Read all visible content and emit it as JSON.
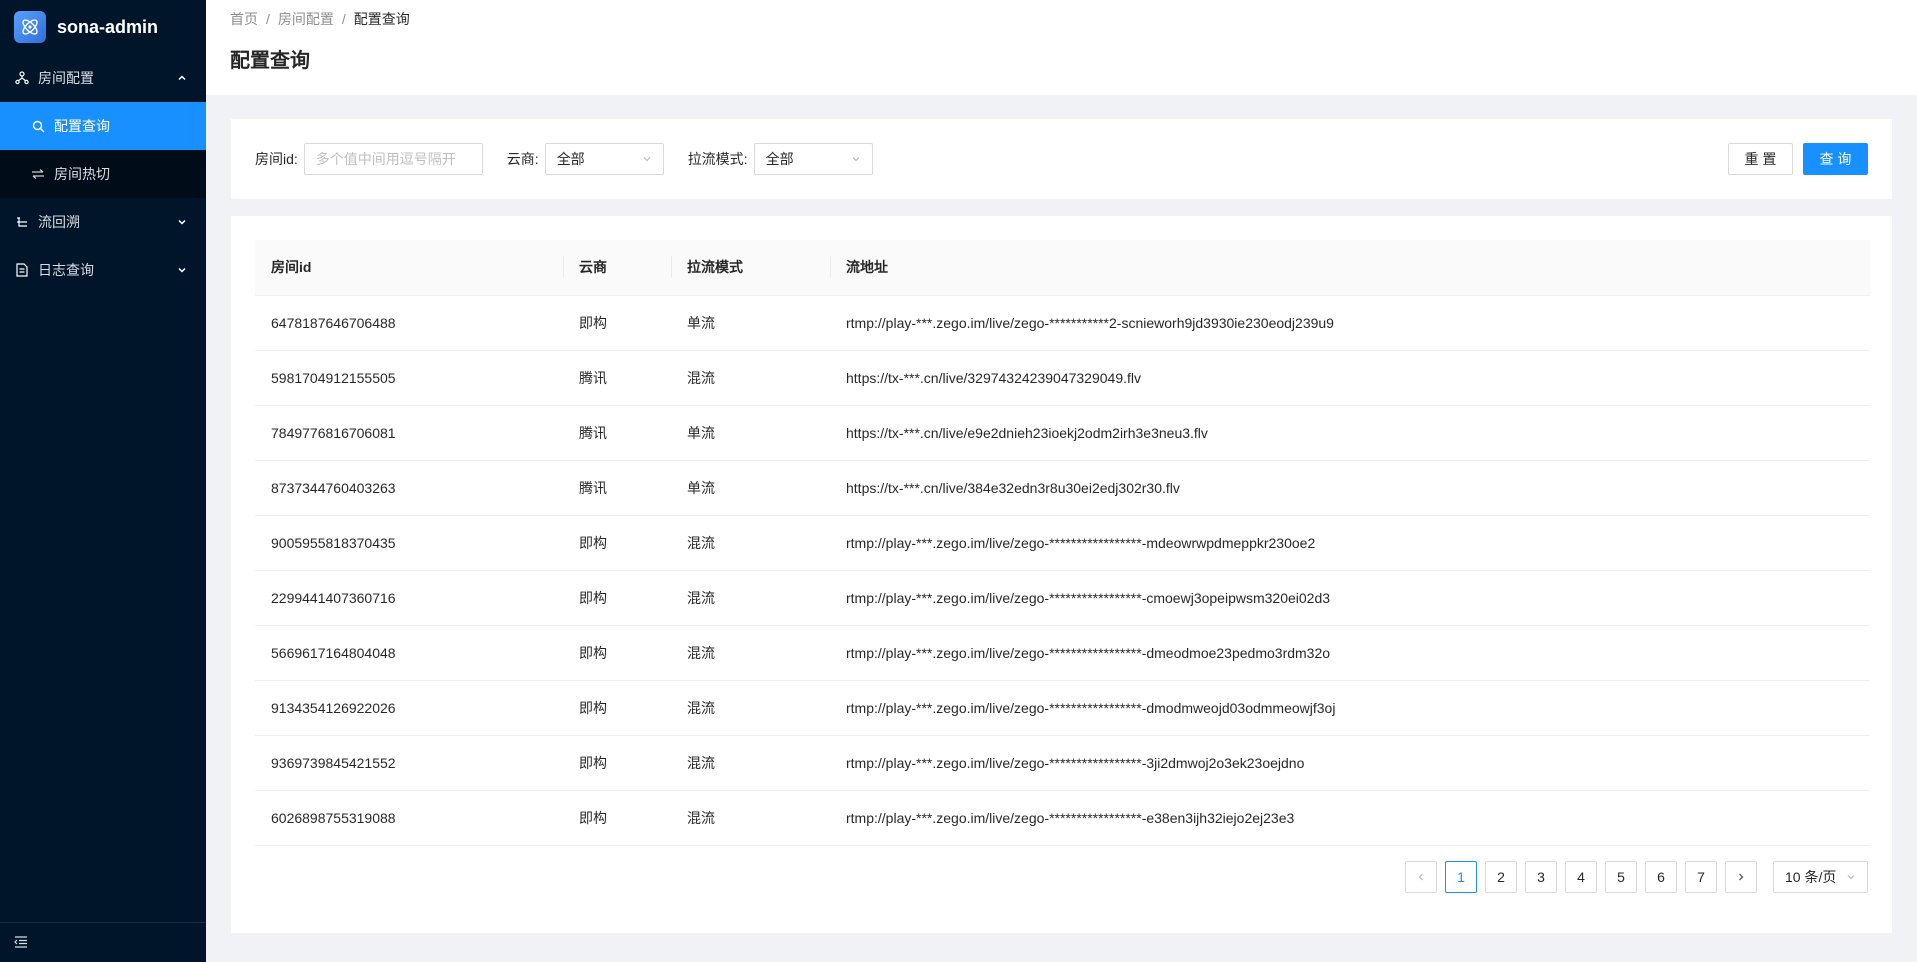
{
  "app": {
    "title": "sona-admin"
  },
  "sidebar": {
    "menus": [
      {
        "label": "房间配置",
        "icon": "cluster-icon",
        "expanded": true,
        "children": [
          {
            "label": "配置查询",
            "icon": "search-icon",
            "active": true
          },
          {
            "label": "房间热切",
            "icon": "swap-icon",
            "active": false
          }
        ]
      },
      {
        "label": "流回溯",
        "icon": "branch-icon",
        "expanded": false
      },
      {
        "label": "日志查询",
        "icon": "file-icon",
        "expanded": false
      }
    ]
  },
  "breadcrumb": {
    "home": "首页",
    "section": "房间配置",
    "current": "配置查询"
  },
  "page_title": "配置查询",
  "filters": {
    "room_id_label": "房间id",
    "room_id_placeholder": "多个值中间用逗号隔开",
    "cloud_label": "云商",
    "cloud_value": "全部",
    "pull_mode_label": "拉流模式",
    "pull_mode_value": "全部",
    "reset_label": "重 置",
    "query_label": "查 询"
  },
  "table": {
    "headers": [
      "房间id",
      "云商",
      "拉流模式",
      "流地址"
    ],
    "rows": [
      [
        "6478187646706488",
        "即构",
        "单流",
        "rtmp://play-***.zego.im/live/zego-***********2-scnieworh9jd3930ie230eodj239u9"
      ],
      [
        "5981704912155505",
        "腾讯",
        "混流",
        "https://tx-***.cn/live/329743242390473290​49.flv"
      ],
      [
        "7849776816706081",
        "腾讯",
        "单流",
        "https://tx-***.cn/live/e9e2dnieh23ioekj2odm2irh3e3neu3.flv"
      ],
      [
        "8737344760403263",
        "腾讯",
        "单流",
        "https://tx-***.cn/live/384e32edn3r8u30ei2edj302r30.flv"
      ],
      [
        "9005955818370435",
        "即构",
        "混流",
        "rtmp://play-***.zego.im/live/zego-*****************-mdeowrwpdmeppkr230oe2"
      ],
      [
        "2299441407360716",
        "即构",
        "混流",
        "rtmp://play-***.zego.im/live/zego-*****************-cmoewj3opeipwsm320ei02d3"
      ],
      [
        "5669617164804048",
        "即构",
        "混流",
        "rtmp://play-***.zego.im/live/zego-*****************-dmeodmoe23pedmo3rdm32o"
      ],
      [
        "9134354126922026",
        "即构",
        "混流",
        "rtmp://play-***.zego.im/live/zego-*****************-dmodmweojd03odmmeowjf3oj"
      ],
      [
        "9369739845421552",
        "即构",
        "混流",
        "rtmp://play-***.zego.im/live/zego-*****************-3ji2dmwoj2o3ek23oejdno"
      ],
      [
        "6026898755319088",
        "即构",
        "混流",
        "rtmp://play-***.zego.im/live/zego-*****************-e38en3ijh32iejo2ej23e3"
      ]
    ]
  },
  "pagination": {
    "pages": [
      "1",
      "2",
      "3",
      "4",
      "5",
      "6",
      "7"
    ],
    "current": "1",
    "page_size": "10 条/页"
  },
  "colors": {
    "primary": "#1890ff",
    "sidebar_bg": "#001529",
    "submenu_bg": "#000c17"
  }
}
